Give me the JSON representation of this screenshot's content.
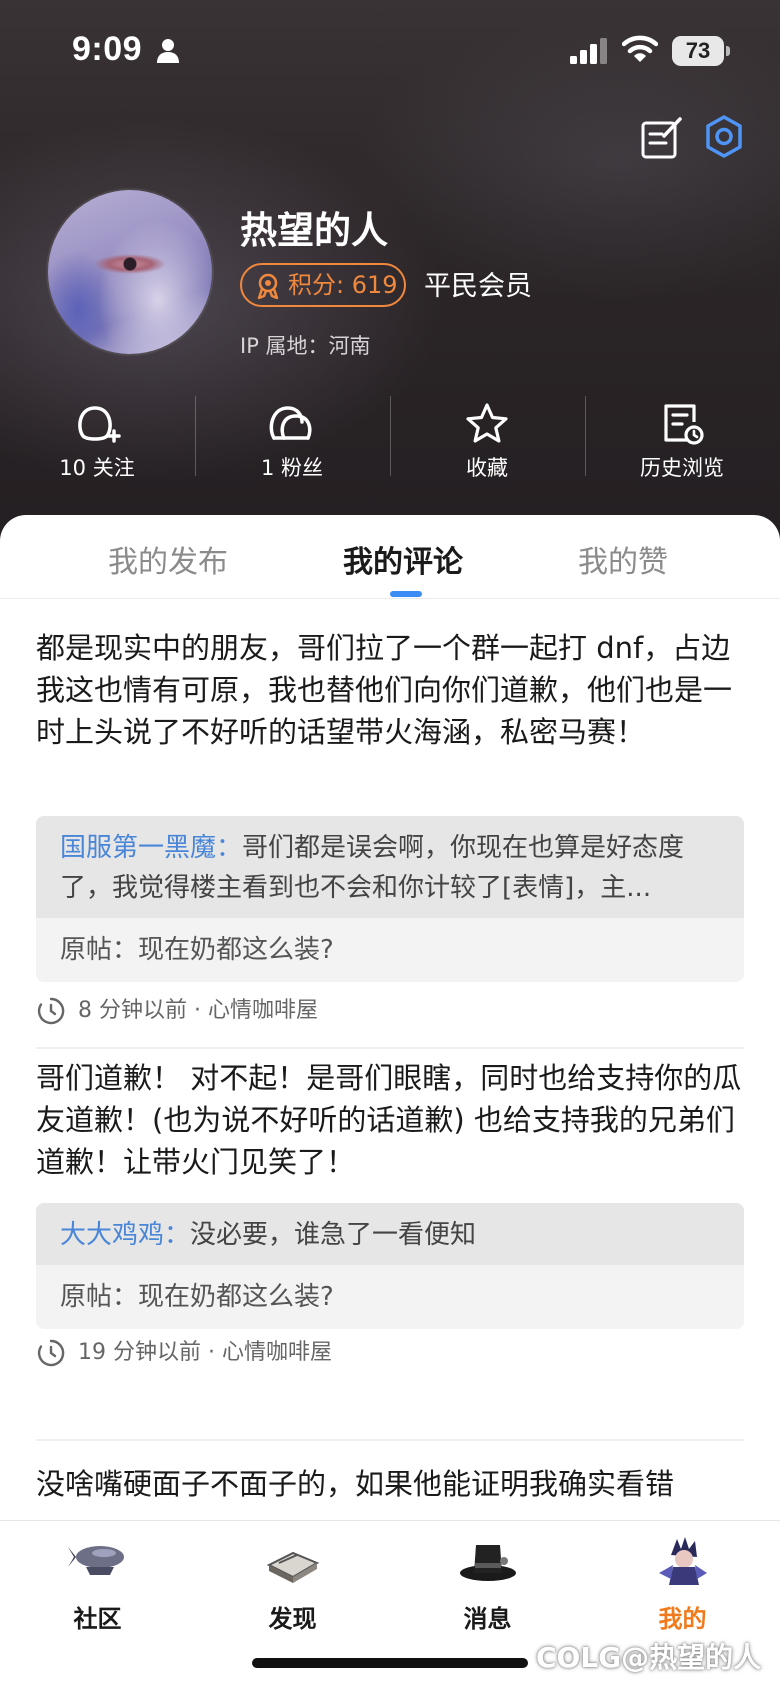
{
  "status_bar": {
    "time": "9:09",
    "battery": "73"
  },
  "profile": {
    "username": "热望的人",
    "points_label": "积分: 619",
    "member_level": "平民会员",
    "ip_location": "IP 属地：河南"
  },
  "stats": [
    {
      "label": "10 关注",
      "icon": "add-user-icon"
    },
    {
      "label": "1 粉丝",
      "icon": "users-icon"
    },
    {
      "label": "收藏",
      "icon": "star-icon"
    },
    {
      "label": "历史浏览",
      "icon": "history-icon"
    }
  ],
  "tabs": [
    {
      "label": "我的发布",
      "active": false
    },
    {
      "label": "我的评论",
      "active": true
    },
    {
      "label": "我的赞",
      "active": false
    }
  ],
  "comments": [
    {
      "body": "都是现实中的朋友，哥们拉了一个群一起打 dnf，占边我这也情有可原，我也替他们向你们道歉，他们也是一时上头说了不好听的话望带火海涵，私密马赛！",
      "reply_author": "国服第一黑魔：",
      "reply_text": "哥们都是误会啊，你现在也算是好态度了，我觉得楼主看到也不会和你计较了[表情]，主...",
      "original_post": "原帖：现在奶都这么装?",
      "time": "8 分钟以前 · 心情咖啡屋"
    },
    {
      "body": "哥们道歉！ 对不起！是哥们眼瞎，同时也给支持你的瓜友道歉！(也为说不好听的话道歉) 也给支持我的兄弟们道歉！让带火门见笑了！",
      "reply_author": "大大鸡鸡：",
      "reply_text": "没必要，谁急了一看便知",
      "original_post": "原帖：现在奶都这么装?",
      "time": "19 分钟以前 · 心情咖啡屋"
    },
    {
      "body": "没啥嘴硬面子不面子的，如果他能证明我确实看错"
    }
  ],
  "bottom_nav": [
    {
      "label": "社区",
      "active": false
    },
    {
      "label": "发现",
      "active": false
    },
    {
      "label": "消息",
      "active": false
    },
    {
      "label": "我的",
      "active": true
    }
  ],
  "watermark": "COLG@热望的人",
  "colors": {
    "accent": "#3b8cf4",
    "orange": "#f07a1c",
    "points": "#f0883e",
    "reply_author": "#4a86d8"
  }
}
